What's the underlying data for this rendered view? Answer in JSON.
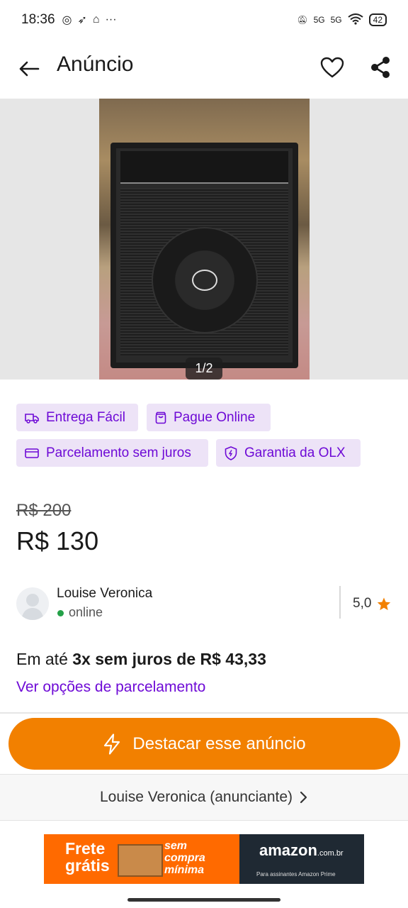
{
  "status_bar": {
    "time": "18:36",
    "battery": "42",
    "network": "5G"
  },
  "app_bar": {
    "title": "Anúncio"
  },
  "gallery": {
    "counter": "1/2"
  },
  "badges": [
    {
      "label": "Entrega Fácil",
      "icon": "truck-icon"
    },
    {
      "label": "Pague Online",
      "icon": "bag-icon"
    },
    {
      "label": "Parcelamento sem juros",
      "icon": "card-icon"
    },
    {
      "label": "Garantia da OLX",
      "icon": "shield-icon"
    }
  ],
  "price": {
    "old": "R$ 200",
    "current": "R$ 130"
  },
  "seller": {
    "name": "Louise Veronica",
    "status": "online",
    "rating": "5,0"
  },
  "installments": {
    "prefix": "Em até ",
    "bold": "3x sem juros de R$ 43,33",
    "link": "Ver opções de parcelamento"
  },
  "cta": {
    "label": "Destacar esse anúncio"
  },
  "advertiser": {
    "label": "Louise Veronica (anunciante)"
  },
  "ad_banner": {
    "frete_line1": "Frete",
    "frete_line2": "grátis",
    "sem_line1": "sem",
    "sem_line2": "compra",
    "sem_line3": "mínima",
    "brand": "amazon",
    "brand_suffix": ".com.br",
    "prime_text": "Para assinantes Amazon Prime"
  },
  "colors": {
    "accent_purple": "#6e0ad6",
    "badge_bg": "#ede3f7",
    "cta_orange": "#f28000",
    "online_green": "#24a148",
    "star": "#f28000"
  }
}
